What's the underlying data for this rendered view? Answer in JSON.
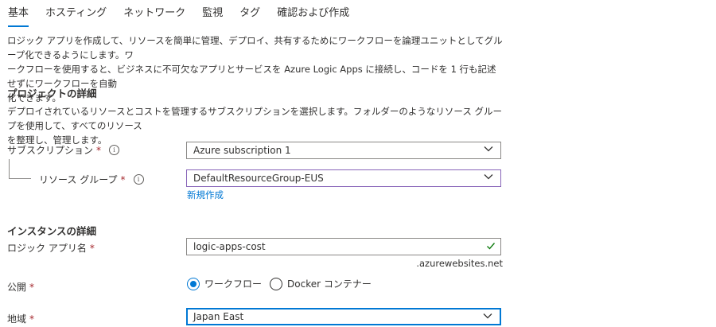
{
  "tabs": [
    {
      "label": "基本",
      "active": true
    },
    {
      "label": "ホスティング",
      "active": false
    },
    {
      "label": "ネットワーク",
      "active": false
    },
    {
      "label": "監視",
      "active": false
    },
    {
      "label": "タグ",
      "active": false
    },
    {
      "label": "確認および作成",
      "active": false
    }
  ],
  "intro": {
    "line1": "ロジック アプリを作成して、リソースを簡単に管理、デプロイ、共有するためにワークフローを論理ユニットとしてグループ化できるようにします。ワ",
    "line2": "ークフローを使用すると、ビジネスに不可欠なアプリとサービスを Azure Logic Apps に接続し、コードを 1 行も記述せずにワークフローを自動",
    "line3": "化できます。"
  },
  "project": {
    "title": "プロジェクトの詳細",
    "desc_line1": "デプロイされているリソースとコストを管理するサブスクリプションを選択します。フォルダーのようなリソース グループを使用して、すべてのリソース",
    "desc_line2": "を整理し、管理します。",
    "subscription_label": "サブスクリプション",
    "subscription_value": "Azure subscription 1",
    "resource_group_label": "リソース グループ",
    "resource_group_value": "DefaultResourceGroup-EUS",
    "create_new_link": "新規作成"
  },
  "instance": {
    "title": "インスタンスの詳細",
    "app_name_label": "ロジック アプリ名",
    "app_name_value": "logic-apps-cost",
    "app_name_suffix": ".azurewebsites.net",
    "publish_label": "公開",
    "publish_options": [
      {
        "label": "ワークフロー",
        "selected": true
      },
      {
        "label": "Docker コンテナー",
        "selected": false
      }
    ],
    "region_label": "地域",
    "region_value": "Japan East"
  },
  "required_marker": "*",
  "info_glyph": "i",
  "colors": {
    "accent": "#0078d4",
    "required": "#a4262c",
    "valid": "#107c10"
  }
}
